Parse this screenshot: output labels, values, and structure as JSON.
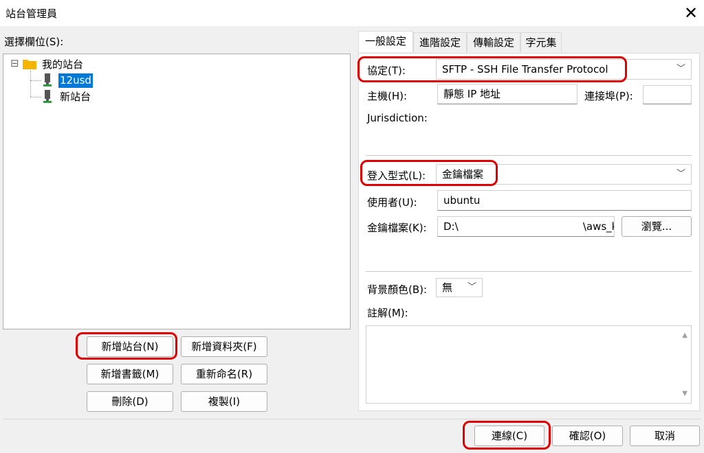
{
  "window": {
    "title": "站台管理員",
    "close_symbol": "✕"
  },
  "left": {
    "select_label": "選擇欄位(S):",
    "tree": {
      "collapse_symbol": "⊟",
      "root_label": "我的站台",
      "sites": [
        {
          "label": "12usd",
          "selected": true
        },
        {
          "label": "新站台",
          "selected": false
        }
      ]
    },
    "buttons": {
      "new_site": "新增站台(N)",
      "new_folder": "新增資料夾(F)",
      "new_bookmark": "新增書籤(M)",
      "rename": "重新命名(R)",
      "delete": "刪除(D)",
      "copy": "複製(I)"
    }
  },
  "tabs": [
    {
      "label": "一般設定",
      "active": true
    },
    {
      "label": "進階設定",
      "active": false
    },
    {
      "label": "傳輸設定",
      "active": false
    },
    {
      "label": "字元集",
      "active": false
    }
  ],
  "general": {
    "protocol_label": "協定(T):",
    "protocol_value": "SFTP - SSH File Transfer Protocol",
    "host_label": "主機(H):",
    "host_value": "靜態 IP 地址",
    "port_label": "連接埠(P):",
    "port_value": "",
    "jurisdiction_label": "Jurisdiction:",
    "login_type_label": "登入型式(L):",
    "login_type_value": "金鑰檔案",
    "user_label": "使用者(U):",
    "user_value": "ubuntu",
    "keyfile_label": "金鑰檔案(K):",
    "keyfile_value": "D:\\                                      \\aws_key\\E",
    "browse_label": "瀏覽...",
    "bgcolor_label": "背景顏色(B):",
    "bgcolor_value": "無",
    "comment_label": "註解(M):",
    "comment_value": ""
  },
  "footer": {
    "connect": "連線(C)",
    "ok": "確認(O)",
    "cancel": "取消"
  },
  "colors": {
    "highlight": "#e00000",
    "selection": "#0078d7",
    "folder": "#f4b400"
  }
}
